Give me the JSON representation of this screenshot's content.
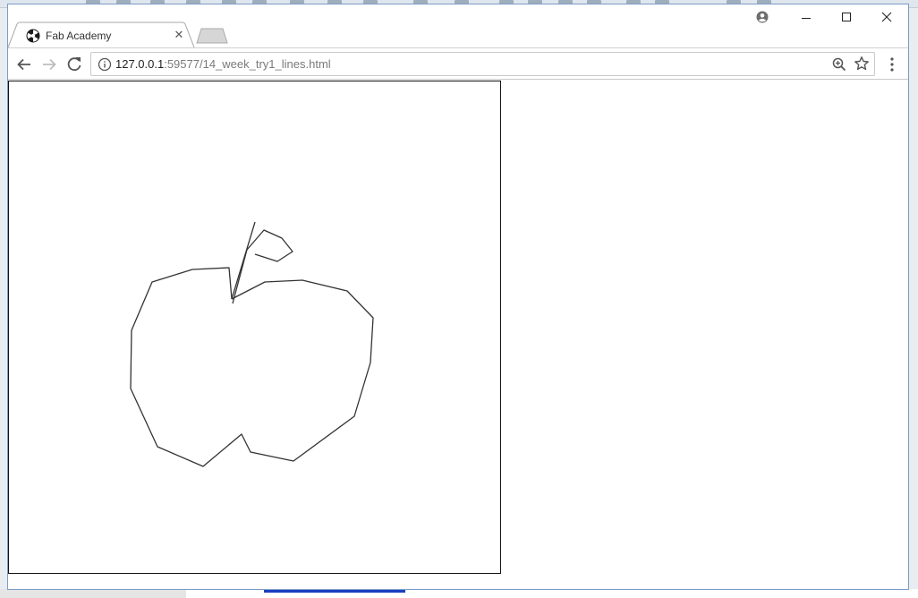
{
  "browser": {
    "tab": {
      "title": "Fab Academy"
    },
    "address_bar": {
      "host": "127.0.0.1",
      "rest": ":59577/14_week_try1_lines.html"
    }
  },
  "page": {
    "canvas": {
      "content": "apple line drawing",
      "stroke_color": "#333333"
    }
  }
}
